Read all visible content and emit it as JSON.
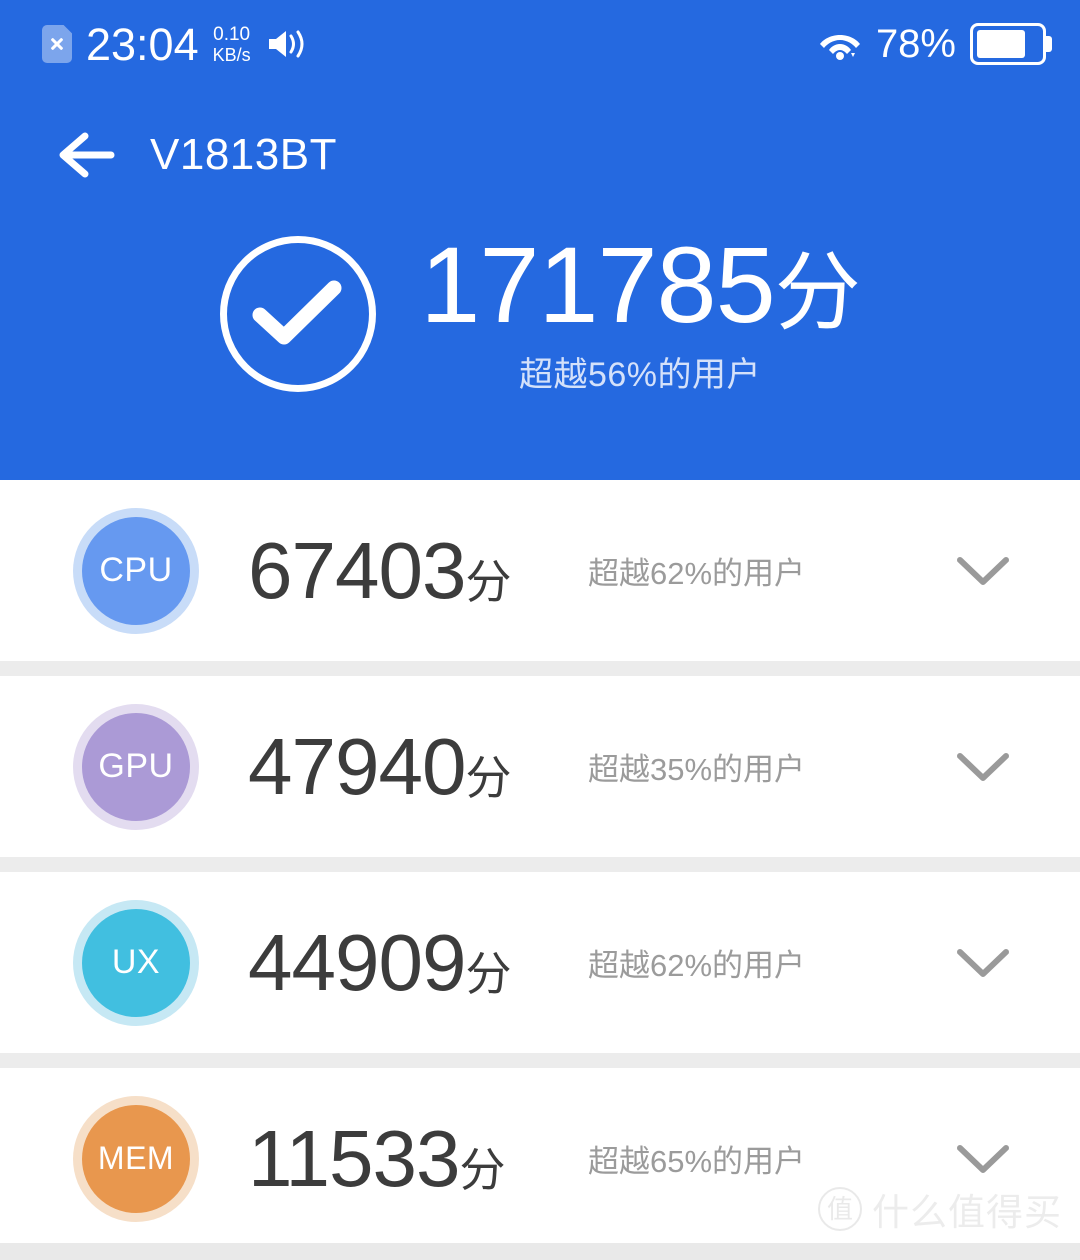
{
  "status_bar": {
    "sim_icon": "sim-card-x-icon",
    "time": "23:04",
    "net_speed_value": "0.10",
    "net_speed_unit": "KB/s",
    "mute_icon": "volume-mute-icon",
    "wifi_icon": "wifi-icon",
    "battery_percent": "78%",
    "battery_icon": "battery-icon"
  },
  "header": {
    "back_icon": "arrow-left-icon",
    "title": "V1813BT",
    "bg_color": "#2569e0"
  },
  "total": {
    "check_icon": "check-circle-icon",
    "score": "171785",
    "unit": "分",
    "subtitle": "超越56%的用户",
    "percentile": 56
  },
  "rows": [
    {
      "key": "cpu",
      "badge_label": "CPU",
      "badge_color": "#6699f0",
      "badge_ring_color": "#c8dcf8",
      "score": "67403",
      "unit": "分",
      "subtitle": "超越62%的用户",
      "percentile": 62,
      "expand_icon": "chevron-down-icon"
    },
    {
      "key": "gpu",
      "badge_label": "GPU",
      "badge_color": "#ab9ad6",
      "badge_ring_color": "#e3dcf0",
      "score": "47940",
      "unit": "分",
      "subtitle": "超越35%的用户",
      "percentile": 35,
      "expand_icon": "chevron-down-icon"
    },
    {
      "key": "ux",
      "badge_label": "UX",
      "badge_color": "#41bfe0",
      "badge_ring_color": "#c6e8f4",
      "score": "44909",
      "unit": "分",
      "subtitle": "超越62%的用户",
      "percentile": 62,
      "expand_icon": "chevron-down-icon"
    },
    {
      "key": "mem",
      "badge_label": "MEM",
      "badge_color": "#e8974e",
      "badge_ring_color": "#f6dfc8",
      "score": "11533",
      "unit": "分",
      "subtitle": "超越65%的用户",
      "percentile": 65,
      "expand_icon": "chevron-down-icon"
    }
  ],
  "watermark": {
    "logo_char": "值",
    "text": "什么值得买"
  }
}
